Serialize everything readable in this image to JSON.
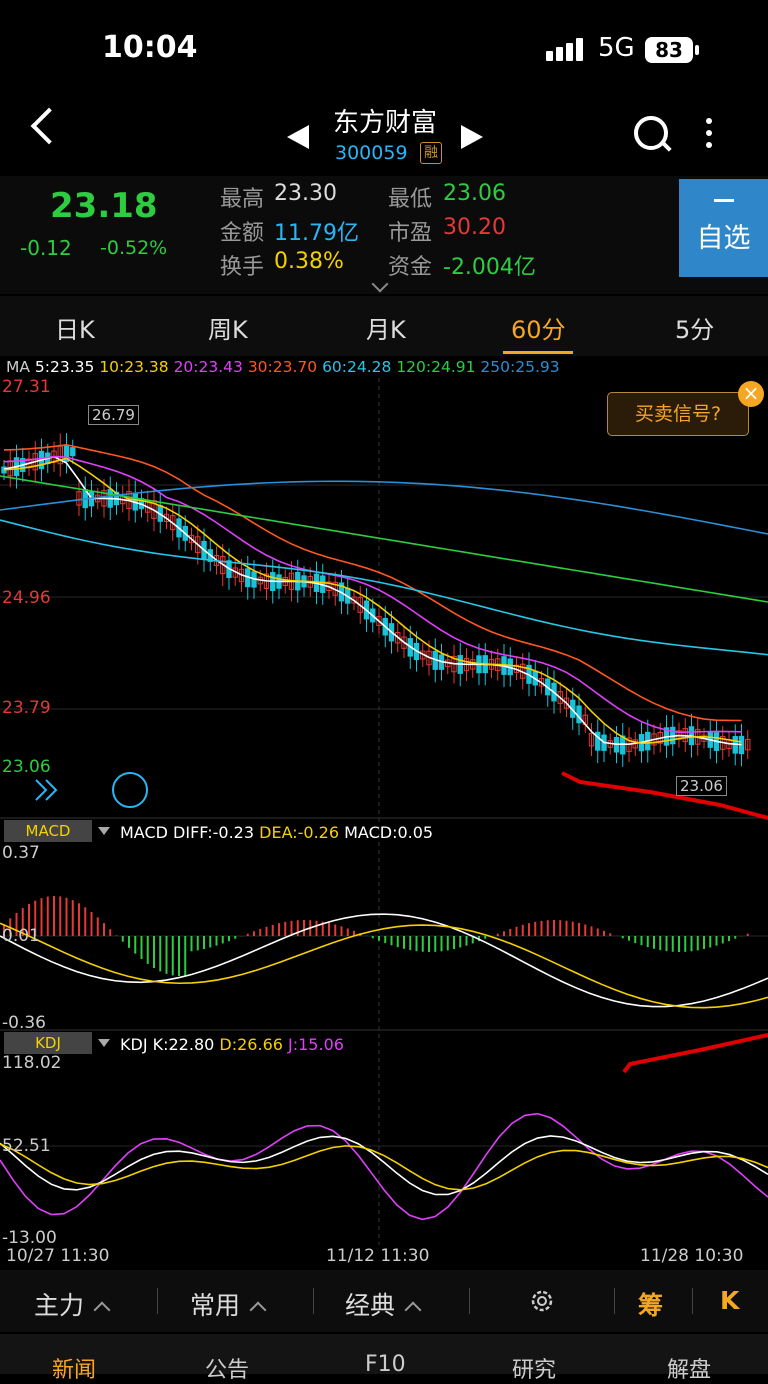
{
  "status_bar": {
    "time": "10:04",
    "network": "5G",
    "battery": "83"
  },
  "header": {
    "title": "东方财富",
    "code": "300059",
    "badge": "融"
  },
  "quote": {
    "price": "23.18",
    "change": "-0.12",
    "change_pct": "-0.52%",
    "high_label": "最高",
    "high": "23.30",
    "low_label": "最低",
    "low": "23.06",
    "amount_label": "金额",
    "amount": "11.79亿",
    "pe_label": "市盈",
    "pe": "30.20",
    "turnover_label": "换手",
    "turnover": "0.38%",
    "fund_label": "资金",
    "fund": "-2.004亿",
    "favorite_label": "自选"
  },
  "period_tabs": [
    "日K",
    "周K",
    "月K",
    "60分",
    "5分"
  ],
  "active_tab": "60分",
  "ma": {
    "label": "MA",
    "items": [
      {
        "text": "5:23.35",
        "color": "#ffffff"
      },
      {
        "text": "10:23.38",
        "color": "#f5d000"
      },
      {
        "text": "20:23.43",
        "color": "#e040fb"
      },
      {
        "text": "30:23.70",
        "color": "#ff5722"
      },
      {
        "text": "60:24.28",
        "color": "#29c5e6"
      },
      {
        "text": "120:24.91",
        "color": "#2ecc40"
      },
      {
        "text": "250:25.93",
        "color": "#2a8fd6"
      }
    ]
  },
  "main_chart": {
    "y_labels": [
      "27.31",
      "24.96",
      "23.79",
      "23.06"
    ],
    "max_marker": "26.79",
    "min_marker": "23.06",
    "signal_button": "买卖信号?"
  },
  "macd": {
    "label": "MACD",
    "diff": "MACD DIFF:-0.23",
    "dea": "DEA:-0.26",
    "macd": "MACD:0.05",
    "y_labels": [
      "0.37",
      "0.01",
      "-0.36"
    ]
  },
  "kdj": {
    "label": "KDJ",
    "k": "KDJ K:22.80",
    "d": "D:26.66",
    "j": "J:15.06",
    "y_labels": [
      "118.02",
      "52.51",
      "-13.00"
    ]
  },
  "dates": [
    "10/27 11:30",
    "11/12 11:30",
    "11/28 10:30"
  ],
  "toolbar": {
    "zhuli": "主力",
    "changyong": "常用",
    "jingdian": "经典",
    "chou": "筹",
    "k": "K"
  },
  "bottom_tabs": [
    "新闻",
    "公告",
    "F10",
    "研究",
    "解盘"
  ],
  "colors": {
    "up": "#e53935",
    "down": "#18c2d8",
    "accent": "#f5a623",
    "green": "#2ecc40"
  }
}
